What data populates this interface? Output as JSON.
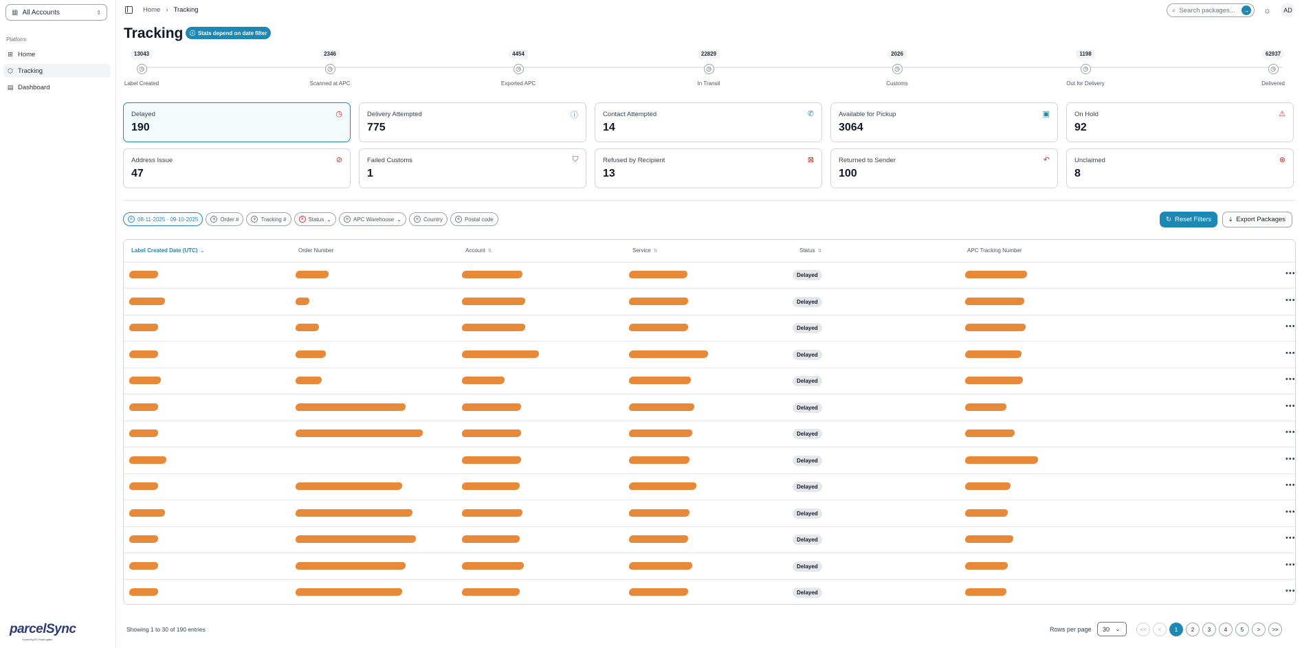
{
  "sidebar": {
    "account_selector": "All Accounts",
    "section": "Platform",
    "items": [
      {
        "label": "Home",
        "icon": "grid-icon"
      },
      {
        "label": "Tracking",
        "icon": "package-icon"
      },
      {
        "label": "Dashboard",
        "icon": "document-icon"
      }
    ],
    "logo": {
      "text": "parcelSync",
      "sub": "Powered by APC Postal Logistics"
    }
  },
  "header": {
    "breadcrumb": [
      "Home",
      "Tracking"
    ],
    "search_placeholder": "Search packages...",
    "avatar": "AD"
  },
  "page": {
    "title": "Tracking",
    "stats_badge": "Stats depend on date filter"
  },
  "timeline": [
    {
      "count": "13043",
      "label": "Label Created"
    },
    {
      "count": "2346",
      "label": "Scanned at APC"
    },
    {
      "count": "4454",
      "label": "Exported APC"
    },
    {
      "count": "22829",
      "label": "In Transit"
    },
    {
      "count": "2026",
      "label": "Customs"
    },
    {
      "count": "1198",
      "label": "Out for Delivery"
    },
    {
      "count": "62937",
      "label": "Delivered"
    }
  ],
  "cards": [
    {
      "label": "Delayed",
      "value": "190",
      "icon": "clock-icon",
      "color": "#dc2626",
      "active": true
    },
    {
      "label": "Delivery Attempted",
      "value": "775",
      "icon": "help-circle-icon",
      "color": "#1e88b4"
    },
    {
      "label": "Contact Attempted",
      "value": "14",
      "icon": "phone-icon",
      "color": "#1e88b4"
    },
    {
      "label": "Available for Pickup",
      "value": "3064",
      "icon": "box-icon",
      "color": "#1e88b4"
    },
    {
      "label": "On Hold",
      "value": "92",
      "icon": "alert-triangle-icon",
      "color": "#dc2626"
    },
    {
      "label": "Address Issue",
      "value": "47",
      "icon": "map-pin-off-icon",
      "color": "#dc2626"
    },
    {
      "label": "Failed Customs",
      "value": "1",
      "icon": "shield-alert-icon",
      "color": "#dc2626"
    },
    {
      "label": "Refused by Recipient",
      "value": "13",
      "icon": "package-x-icon",
      "color": "#dc2626"
    },
    {
      "label": "Returned to Sender",
      "value": "100",
      "icon": "undo-icon",
      "color": "#dc2626"
    },
    {
      "label": "Unclaimed",
      "value": "8",
      "icon": "x-circle-icon",
      "color": "#dc2626"
    }
  ],
  "filters": [
    {
      "label": "08-11-2025 - 09-10-2025",
      "style": "blue"
    },
    {
      "label": "Order #",
      "style": "plain"
    },
    {
      "label": "Tracking #",
      "style": "plain"
    },
    {
      "label": "Status",
      "style": "red",
      "dropdown": true
    },
    {
      "label": "APC Warehouse",
      "style": "plain",
      "dropdown": true
    },
    {
      "label": "Country",
      "style": "plain"
    },
    {
      "label": "Postal code",
      "style": "plain"
    }
  ],
  "actions": {
    "reset": "Reset Filters",
    "export": "Export Packages"
  },
  "table": {
    "columns": [
      "Label Created Date (UTC)",
      "Order Number",
      "Account",
      "Service",
      "Status",
      "APC Tracking Number"
    ],
    "row_status": "Delayed",
    "row_count": 13
  },
  "footer": {
    "showing": "Showing 1 to 30 of 190 entries",
    "rows_per_page_label": "Rows per page",
    "rows_per_page": "30",
    "pages": [
      "<<",
      "<",
      "1",
      "2",
      "3",
      "4",
      "5",
      ">",
      ">>"
    ],
    "current_page": "1"
  },
  "colors": {
    "accent": "#1e88b4",
    "redaction": "#e8893a"
  }
}
